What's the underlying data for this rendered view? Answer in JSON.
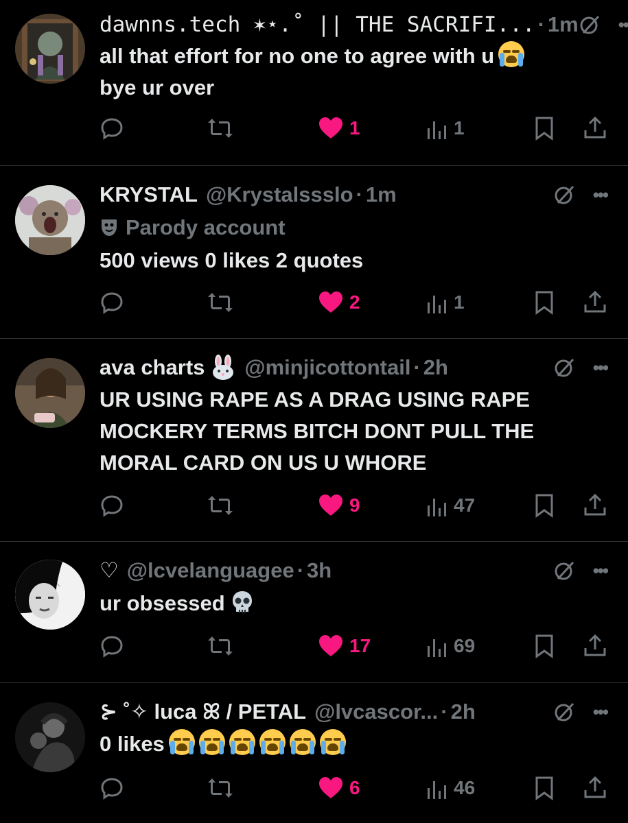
{
  "colors": {
    "background": "#000000",
    "text": "#e7e9ea",
    "muted": "#71767b",
    "like": "#f91880",
    "divider": "#2f3336"
  },
  "tweets": [
    {
      "name": "dawnns.tech ✶⋆.˚ || THE SACRIFI...",
      "handle": "",
      "time": "1m",
      "parody": "",
      "text": "all that effort for no one to agree with u",
      "text2": "bye ur over",
      "likes": "1",
      "views": "1",
      "avatar_icon": "avatar-dawnns"
    },
    {
      "name": "KRYSTAL",
      "handle": "@Krystalssslo",
      "time": "1m",
      "parody": "Parody account",
      "text": "500 views 0 likes 2 quotes",
      "likes": "2",
      "views": "1",
      "avatar_icon": "avatar-krystal"
    },
    {
      "name": "ava charts",
      "handle": "@minjicottontail",
      "time": "2h",
      "parody": "",
      "text": "UR USING RAPE AS A DRAG USING RAPE MOCKERY TERMS BITCH DONT PULL THE MORAL CARD ON US U WHORE",
      "likes": "9",
      "views": "47",
      "avatar_icon": "avatar-ava"
    },
    {
      "name": "♡",
      "handle": "@lcvelanguagee",
      "time": "3h",
      "parody": "",
      "text": "ur obsessed",
      "likes": "17",
      "views": "69",
      "avatar_icon": "avatar-lcve"
    },
    {
      "name": "⊱ ˚✧ luca ꕤ / PETAL",
      "handle": "@lvcascor...",
      "time": "2h",
      "parody": "",
      "text": "0 likes",
      "likes": "6",
      "views": "46",
      "avatar_icon": "avatar-luca"
    }
  ]
}
